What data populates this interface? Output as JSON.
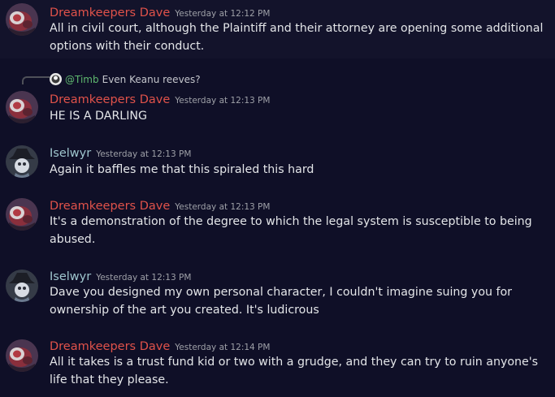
{
  "colors": {
    "background": "#0f0f27",
    "dave_name": "#e0524a",
    "iselwyr_name": "#9fc6ce",
    "timestamp": "#9ea0a7",
    "mention": "#5fb86f"
  },
  "messages": [
    {
      "author": "Dreamkeepers Dave",
      "timestamp": "Yesterday at 12:12 PM",
      "text": "All in civil court, although the Plaintiff and their attorney are opening some additional options with their conduct."
    },
    {
      "reply": {
        "mention": "@Timb",
        "text": "Even Keanu reeves?"
      },
      "author": "Dreamkeepers Dave",
      "timestamp": "Yesterday at 12:13 PM",
      "text": "HE IS A DARLING"
    },
    {
      "author": "Iselwyr",
      "timestamp": "Yesterday at 12:13 PM",
      "text": "Again it baffles me that this spiraled this hard"
    },
    {
      "author": "Dreamkeepers Dave",
      "timestamp": "Yesterday at 12:13 PM",
      "text": "It's a demonstration of the degree to which the legal system is susceptible to being abused."
    },
    {
      "author": "Iselwyr",
      "timestamp": "Yesterday at 12:13 PM",
      "text": "Dave you designed my own personal character, I couldn't imagine suing you for ownership of the art you created. It's ludicrous"
    },
    {
      "author": "Dreamkeepers Dave",
      "timestamp": "Yesterday at 12:14 PM",
      "text": "All it takes is a trust fund kid or two with a grudge, and they can try to ruin anyone's life that they please."
    }
  ]
}
